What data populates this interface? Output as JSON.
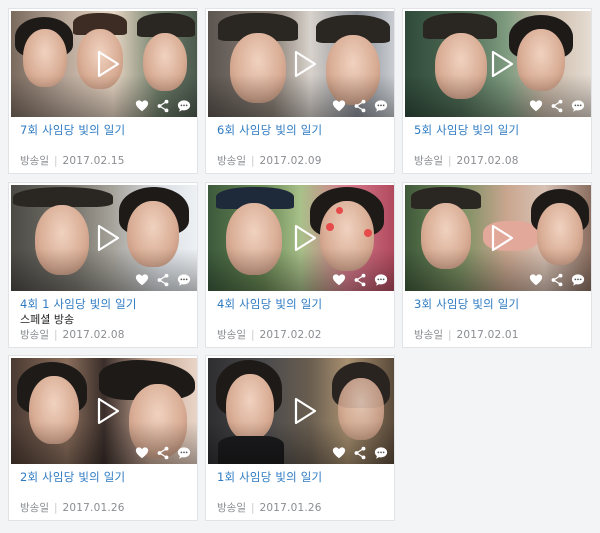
{
  "meta_label": "방송일",
  "meta_separator": "|",
  "episodes": [
    {
      "title": "7회 사임당 빛의 일기",
      "subtitle": "",
      "date": "2017.02.15"
    },
    {
      "title": "6회 사임당 빛의 일기",
      "subtitle": "",
      "date": "2017.02.09"
    },
    {
      "title": "5회 사임당 빛의 일기",
      "subtitle": "",
      "date": "2017.02.08"
    },
    {
      "title": "4회 1 사임당 빛의 일기",
      "subtitle": "스페셜 방송",
      "date": "2017.02.08"
    },
    {
      "title": "4회 사임당 빛의 일기",
      "subtitle": "",
      "date": "2017.02.02"
    },
    {
      "title": "3회 사임당 빛의 일기",
      "subtitle": "",
      "date": "2017.02.01"
    },
    {
      "title": "2회 사임당 빛의 일기",
      "subtitle": "",
      "date": "2017.01.26"
    },
    {
      "title": "1회 사임당 빛의 일기",
      "subtitle": "",
      "date": "2017.01.26"
    }
  ],
  "icons": {
    "play": "play-icon",
    "like": "heart-icon",
    "share": "share-icon",
    "comment": "comment-icon"
  },
  "colors": {
    "title": "#2f7bc2",
    "meta": "#8a8d91",
    "page_bg": "#f3f4f6",
    "card_border": "#e1e3e6"
  }
}
